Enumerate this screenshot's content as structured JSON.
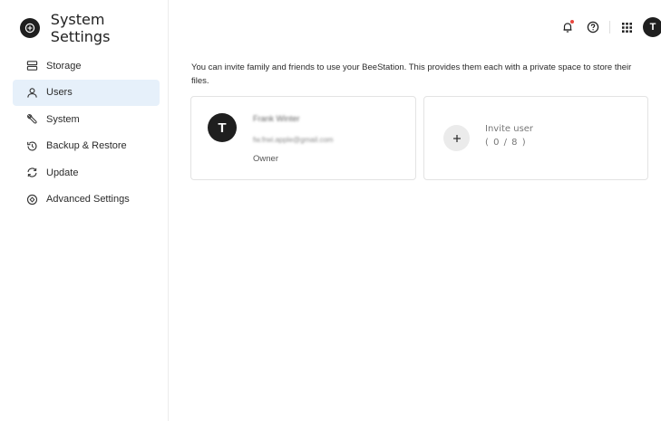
{
  "app": {
    "title": "System Settings"
  },
  "sidebar": {
    "items": [
      {
        "label": "Storage",
        "icon": "storage-icon",
        "active": false
      },
      {
        "label": "Users",
        "icon": "user-icon",
        "active": true
      },
      {
        "label": "System",
        "icon": "wrench-icon",
        "active": false
      },
      {
        "label": "Backup & Restore",
        "icon": "backup-restore-icon",
        "active": false
      },
      {
        "label": "Update",
        "icon": "update-icon",
        "active": false
      },
      {
        "label": "Advanced Settings",
        "icon": "advanced-settings-icon",
        "active": false
      }
    ]
  },
  "topbar": {
    "icons": [
      "bell-icon",
      "help-icon",
      "apps-grid-icon"
    ],
    "avatar_initial": "T",
    "notification_color": "#e9483f"
  },
  "main": {
    "description": "You can invite family and friends to use your BeeStation. This provides them each with a private space to store their files.",
    "user_card": {
      "initial": "T",
      "name": "Frank Winter",
      "email": "fw.frwi.apple@gmail.com",
      "role": "Owner"
    },
    "invite_card": {
      "label": "Invite user",
      "count": "( 0 / 8 )"
    }
  },
  "colors": {
    "active_nav_bg": "#e6f0fa",
    "avatar_bg": "#1f1f1f"
  }
}
